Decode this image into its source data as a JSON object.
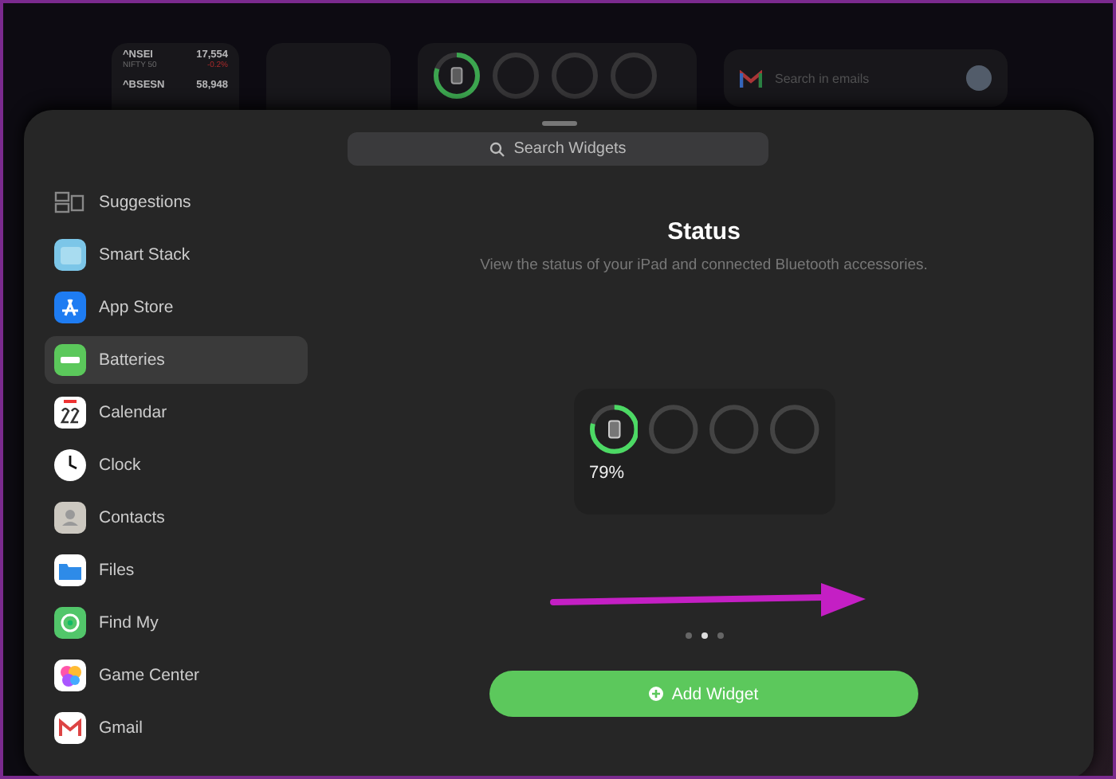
{
  "background_widgets": {
    "stocks": [
      {
        "symbol": "^NSEI",
        "value": "17,554",
        "index": "NIFTY 50",
        "change": "-0.2%"
      },
      {
        "symbol": "^BSESN",
        "value": "58,948"
      }
    ],
    "batteries": [
      {
        "kind": "device",
        "level": 0.8
      },
      {
        "kind": "empty"
      },
      {
        "kind": "empty"
      },
      {
        "kind": "empty"
      }
    ],
    "gmail": {
      "placeholder": "Search in emails"
    }
  },
  "search": {
    "placeholder": "Search Widgets"
  },
  "sidebar": {
    "items": [
      {
        "label": "Suggestions",
        "selected": false
      },
      {
        "label": "Smart Stack",
        "selected": false
      },
      {
        "label": "App Store",
        "selected": false
      },
      {
        "label": "Batteries",
        "selected": true
      },
      {
        "label": "Calendar",
        "selected": false
      },
      {
        "label": "Clock",
        "selected": false
      },
      {
        "label": "Contacts",
        "selected": false
      },
      {
        "label": "Files",
        "selected": false
      },
      {
        "label": "Find My",
        "selected": false
      },
      {
        "label": "Game Center",
        "selected": false
      },
      {
        "label": "Gmail",
        "selected": false
      }
    ]
  },
  "widget": {
    "title": "Status",
    "description": "View the status of your iPad and connected Bluetooth accessories.",
    "devices": [
      {
        "kind": "device",
        "level": 0.79
      },
      {
        "kind": "empty"
      },
      {
        "kind": "empty"
      },
      {
        "kind": "empty"
      }
    ],
    "reading": "79%"
  },
  "pages": [
    {
      "selected": false
    },
    {
      "selected": true
    },
    {
      "selected": false
    }
  ],
  "add_button": {
    "label": "Add Widget"
  }
}
